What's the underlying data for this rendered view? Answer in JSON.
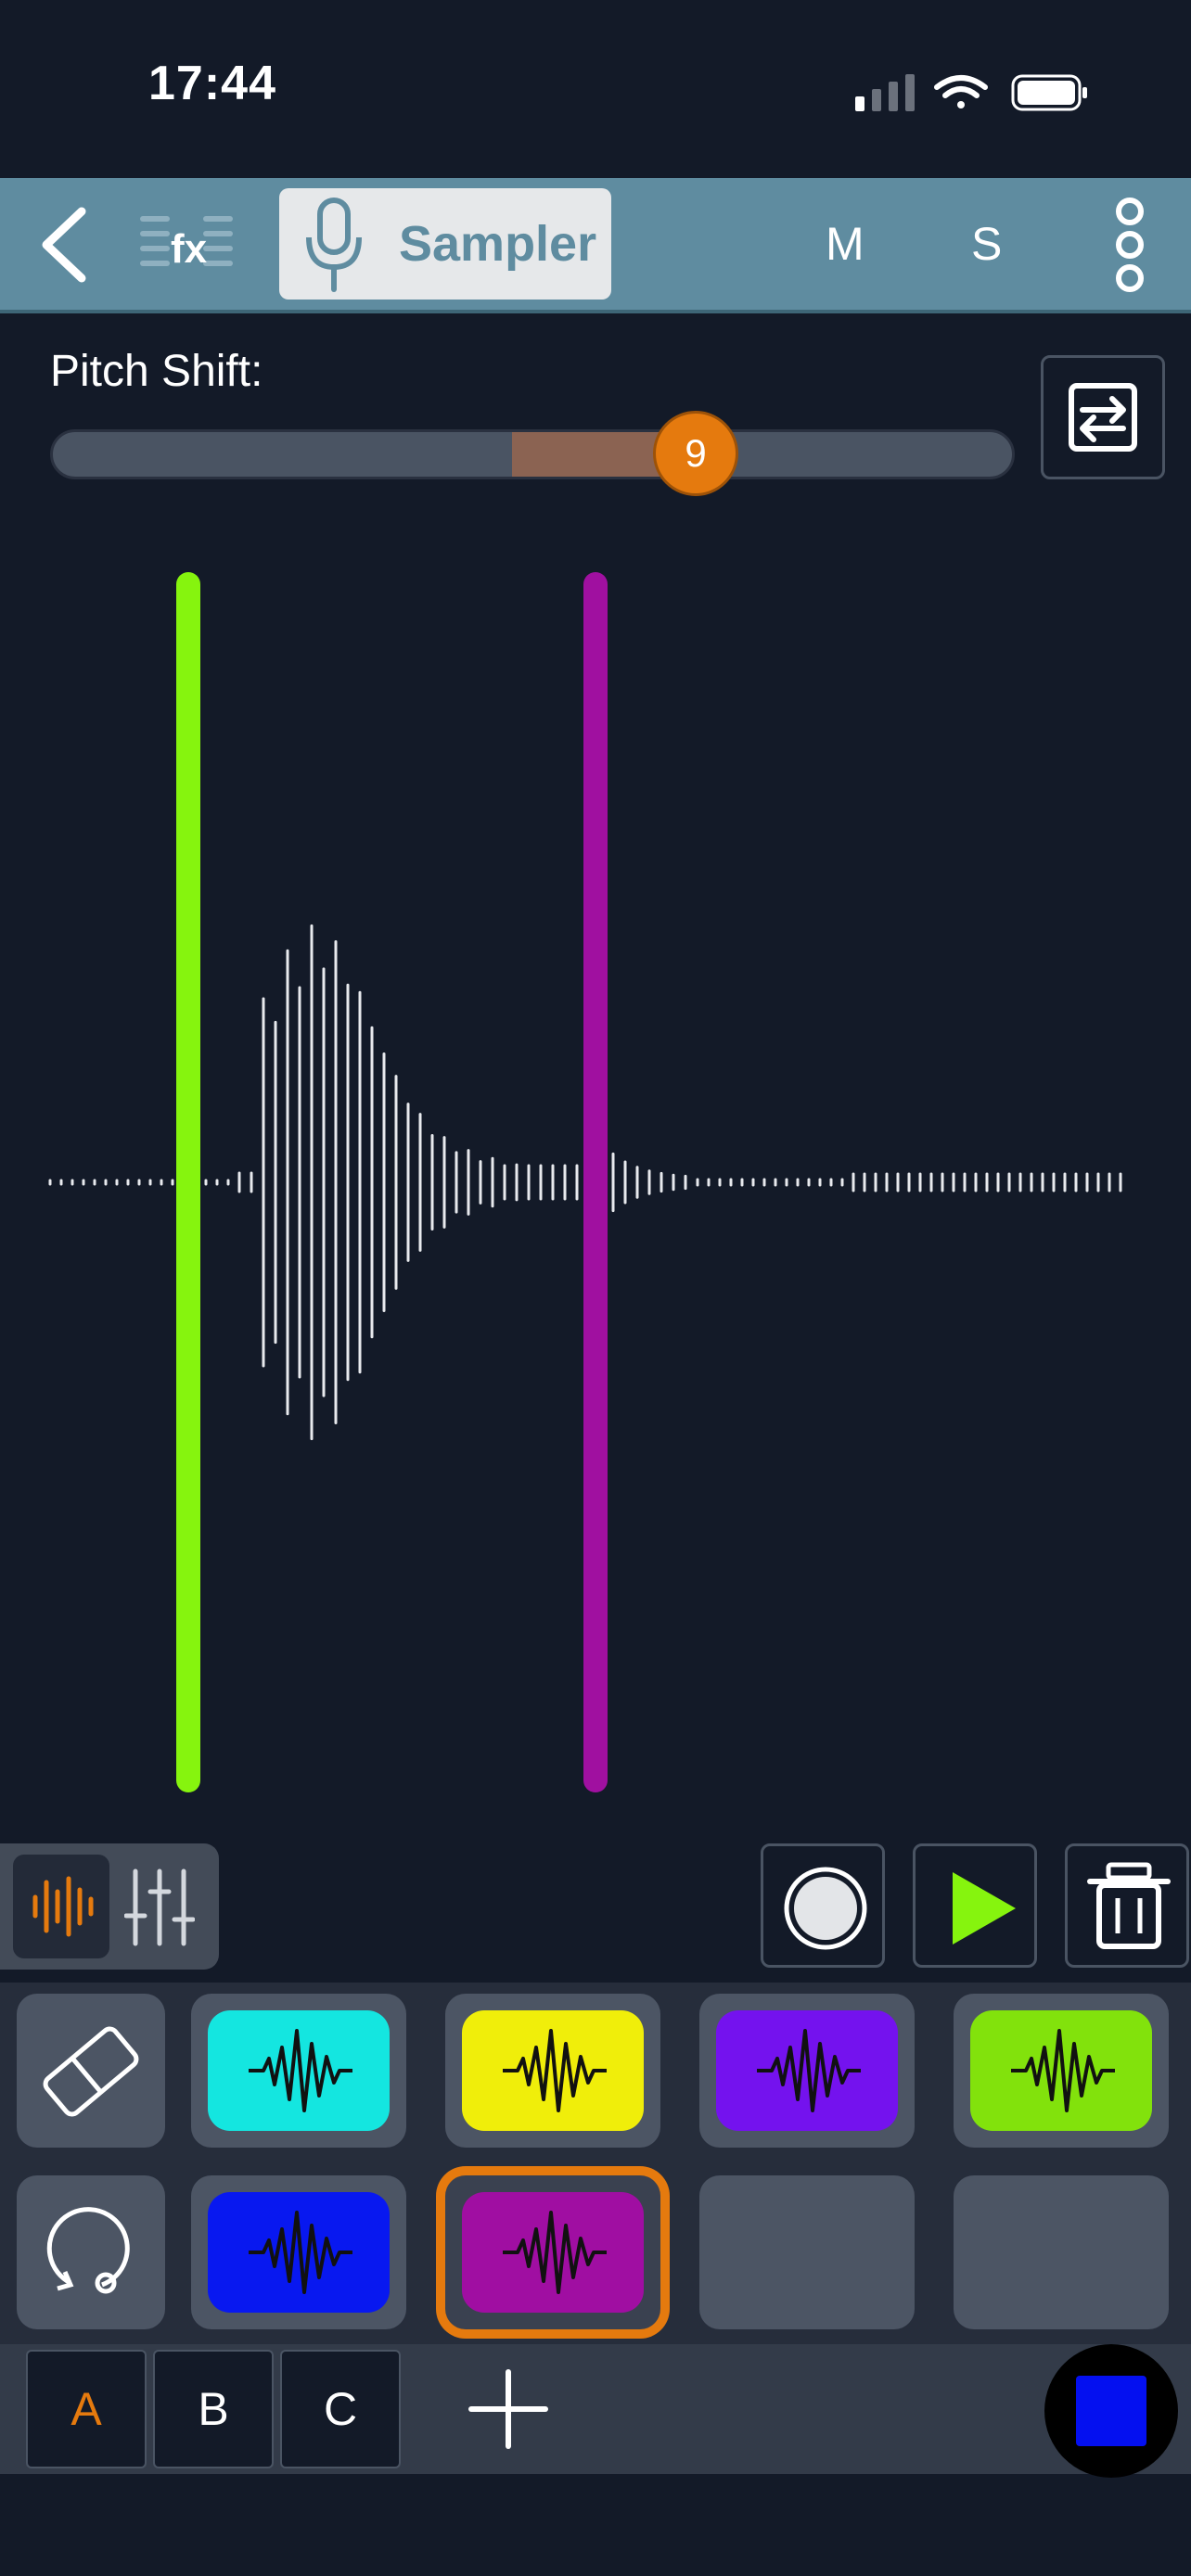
{
  "status_bar": {
    "time": "17:44"
  },
  "toolbar": {
    "fx_label": "fx",
    "instrument_label": "Sampler",
    "mute_label": "M",
    "solo_label": "S"
  },
  "pitch": {
    "label": "Pitch Shift:",
    "value": "9"
  },
  "banks": {
    "tabs": [
      "A",
      "B",
      "C"
    ],
    "active": "A"
  },
  "colors": {
    "start_marker": "#86f40e",
    "end_marker": "#a010a0",
    "accent": "#e57a0e",
    "toolbar": "#5f8ca0",
    "pads": [
      "#14e6e0",
      "#f0ee0a",
      "#7412ee",
      "#82e20c",
      "#0818f0",
      "#a00ea2"
    ]
  },
  "pads": [
    {
      "color": "#14e6e0"
    },
    {
      "color": "#f0ee0a"
    },
    {
      "color": "#7412ee"
    },
    {
      "color": "#82e20c"
    },
    {
      "color": "#0818f0"
    },
    {
      "color": "#a00ea2",
      "selected": true
    },
    {
      "empty": true
    },
    {
      "empty": true
    }
  ],
  "icons": [
    "back-icon",
    "fx-icon",
    "microphone-icon",
    "more-icon",
    "swap-icon",
    "waveform-view-icon",
    "mixer-icon",
    "record-icon",
    "play-icon",
    "trash-icon",
    "eraser-icon",
    "loop-icon",
    "plus-icon",
    "stop-icon"
  ]
}
